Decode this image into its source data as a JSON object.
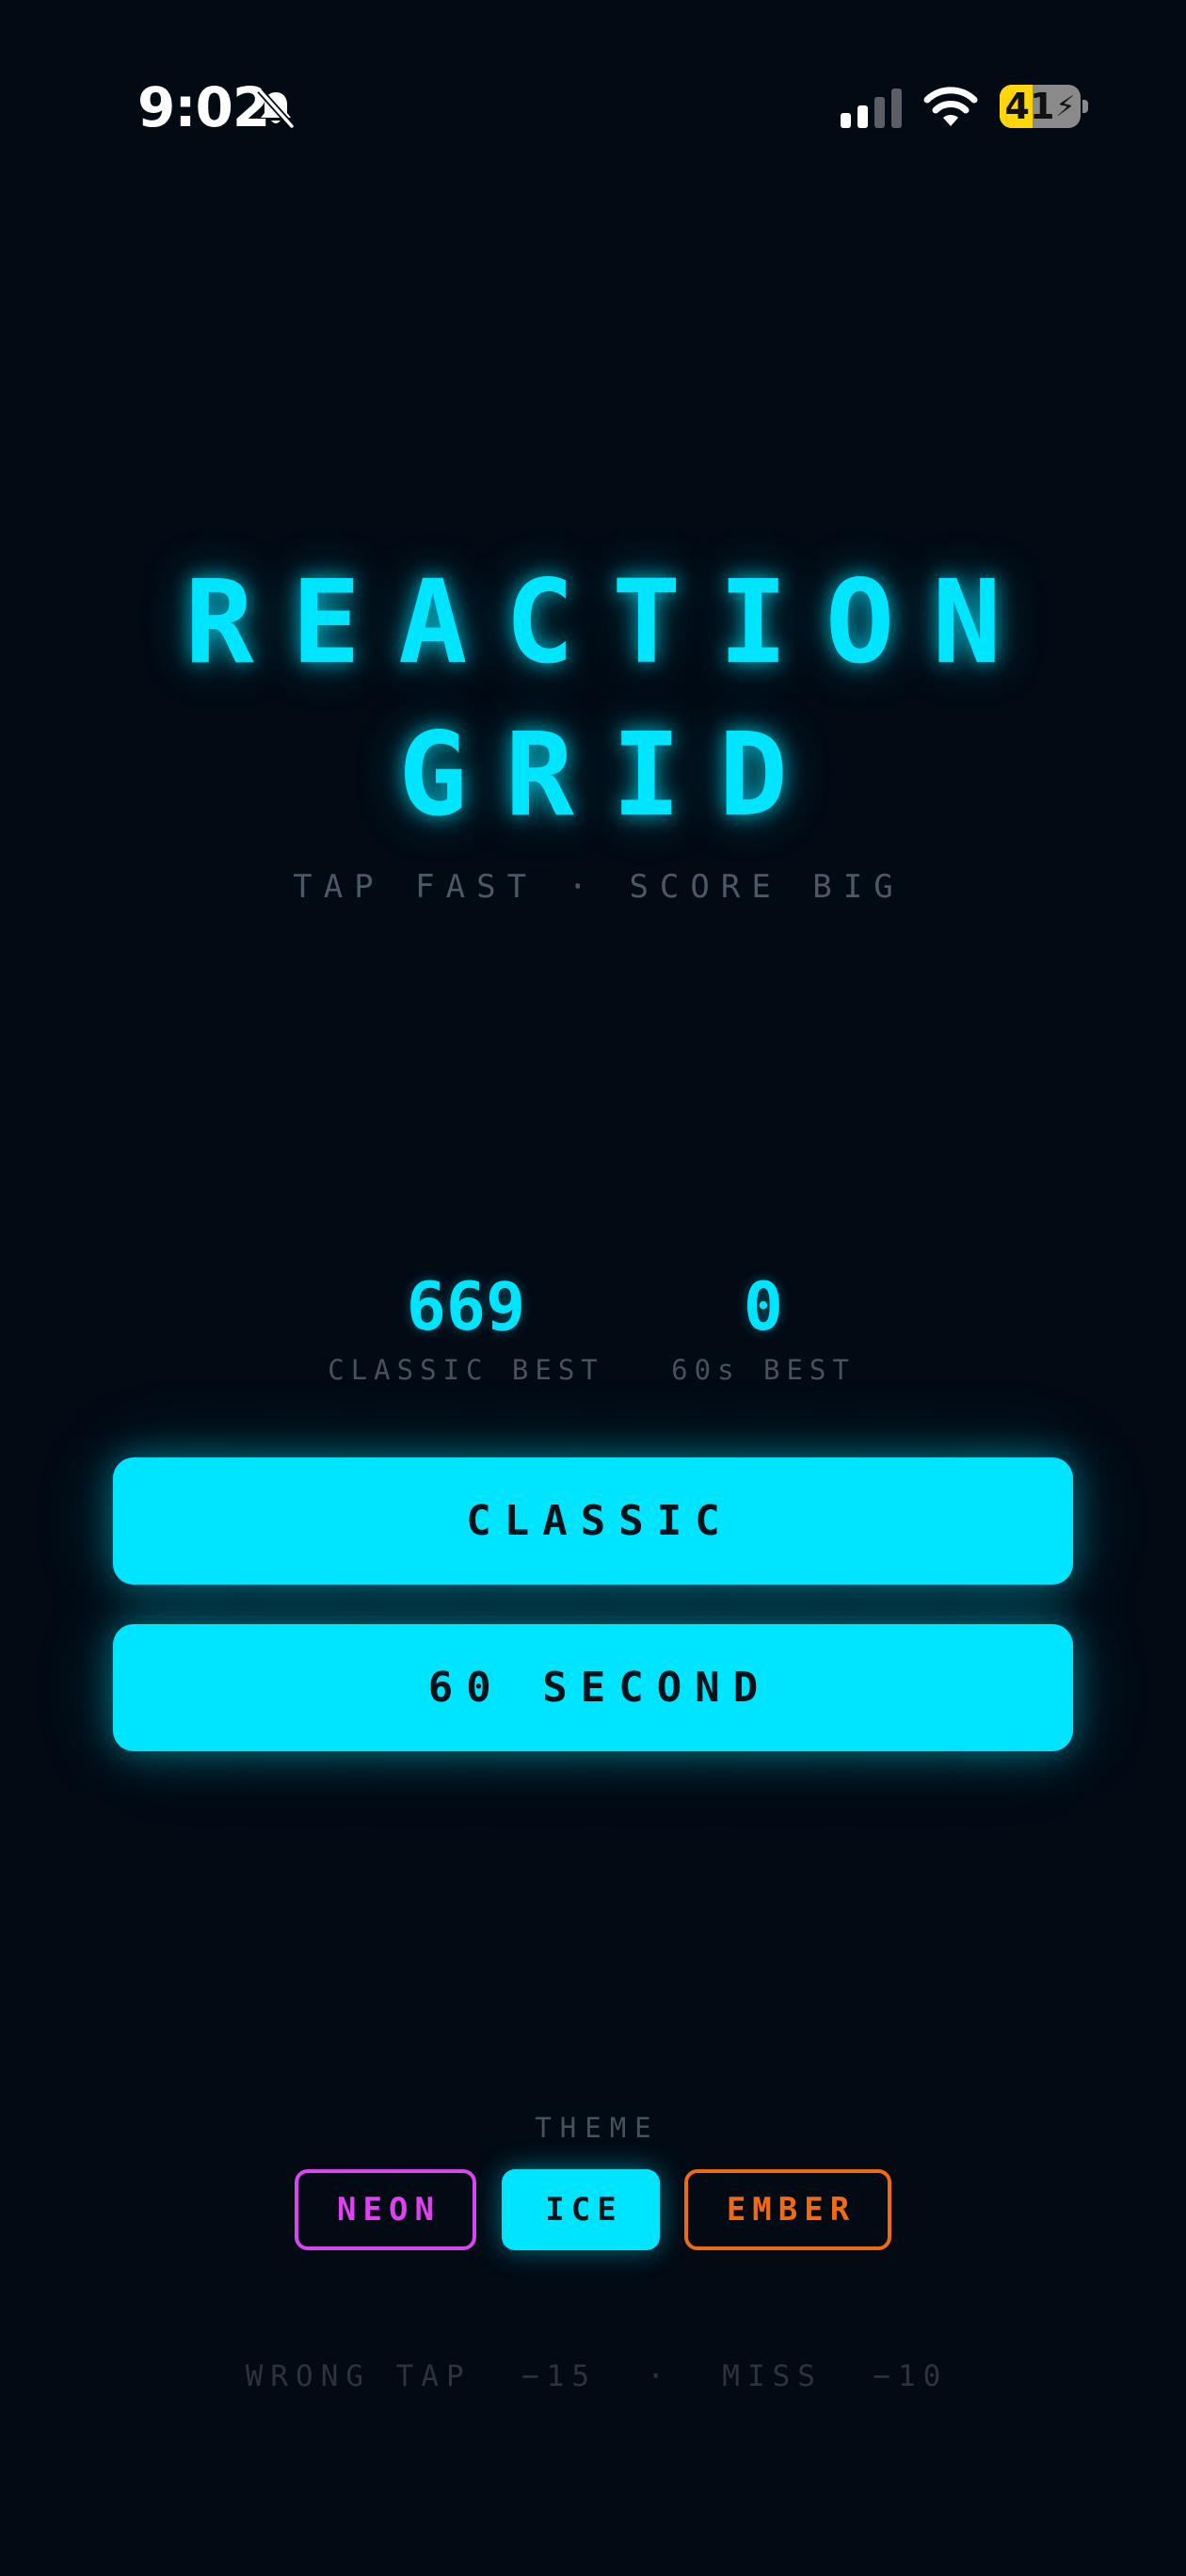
{
  "status_bar": {
    "time": "9:02",
    "battery_level": "41",
    "battery_fraction": 0.41,
    "battery_color": "#ffd60a",
    "icons": [
      "bell-slash-icon",
      "signal-icon",
      "wifi-icon",
      "battery-charging-icon"
    ]
  },
  "title": {
    "line1": "REACTION",
    "line2": "GRID",
    "tagline": "TAP FAST · SCORE BIG"
  },
  "stats": {
    "classic_best_value": "669",
    "classic_best_label": "CLASSIC BEST",
    "sixty_best_value": "0",
    "sixty_best_label": "60s BEST"
  },
  "modes": {
    "classic_label": "CLASSIC",
    "sixty_label": "60 SECOND"
  },
  "theme": {
    "label": "THEME",
    "options": [
      "NEON",
      "ICE",
      "EMBER"
    ],
    "selected": "ICE",
    "colors": {
      "neon": "#d946ef",
      "ice": "#00e5ff",
      "ember": "#f26a0f"
    }
  },
  "footer": {
    "penalties": "WRONG TAP  −15  ·  MISS  −10"
  },
  "colors": {
    "background": "#020a14",
    "accent": "#00e5ff",
    "muted_text": "#46525c"
  }
}
